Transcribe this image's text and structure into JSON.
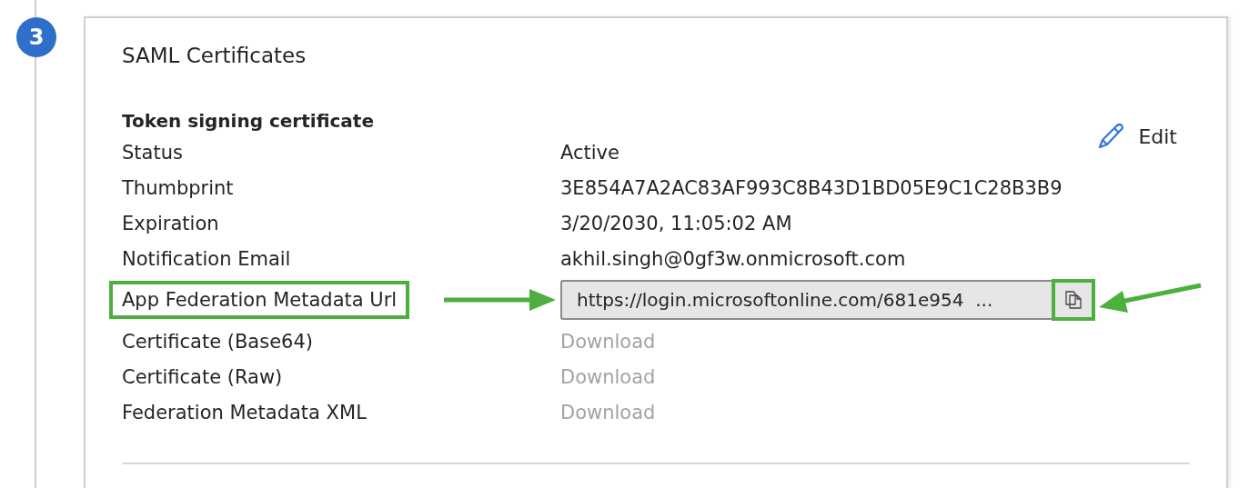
{
  "step": {
    "number": "3"
  },
  "card": {
    "title": "SAML Certificates",
    "section_title": "Token signing certificate",
    "edit_label": "Edit",
    "rows": [
      {
        "kind": "text",
        "label": "Status",
        "value": "Active",
        "highlighted": false
      },
      {
        "kind": "text",
        "label": "Thumbprint",
        "value": "3E854A7A2AC83AF993C8B43D1BD05E9C1C28B3B9",
        "highlighted": false
      },
      {
        "kind": "text",
        "label": "Expiration",
        "value": "3/20/2030, 11:05:02 AM",
        "highlighted": false
      },
      {
        "kind": "text",
        "label": "Notification Email",
        "value": "akhil.singh@0gf3w.onmicrosoft.com",
        "highlighted": false
      },
      {
        "kind": "field",
        "label": "App Federation Metadata Url",
        "value": "https://login.microsoftonline.com/681e954  ...",
        "highlighted": true,
        "copy_highlighted": true
      },
      {
        "kind": "link",
        "label": "Certificate (Base64)",
        "value": "Download",
        "disabled": true,
        "highlighted": false
      },
      {
        "kind": "link",
        "label": "Certificate (Raw)",
        "value": "Download",
        "disabled": true,
        "highlighted": false
      },
      {
        "kind": "link",
        "label": "Federation Metadata XML",
        "value": "Download",
        "disabled": true,
        "highlighted": false
      }
    ]
  }
}
